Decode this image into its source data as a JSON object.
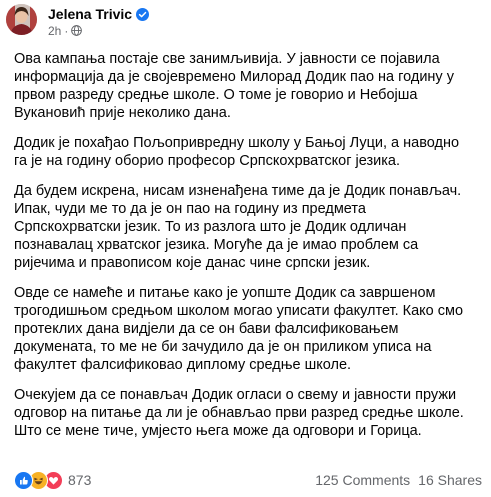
{
  "post": {
    "author_name": "Jelena Trivic",
    "time": "2h",
    "paragraphs": [
      {
        "lines": [
          "Ова кампања постаје све занимљивија. У јавности се појавила",
          "информација да је својевремено Милорад Додик пао на годину у",
          "првом разреду средње школе. О томе је говорио и Небојша",
          "Вукановић прије неколико дана."
        ]
      },
      {
        "lines": [
          "Додик је похађао Пољопривредну школу у Бањој Луци, а наводно",
          "га је на годину оборио професор Српскохрватског језика."
        ]
      },
      {
        "lines": [
          "Да будем искрена, нисам изненађена тиме да је Додик понављач.",
          "Ипак, чуди ме то да је он пао на годину из предмета",
          "Српскохрватски језик. То из разлога што је Додик одличан",
          "познавалац хрватског језика. Могуће да је имао проблем са",
          "ријечима и правописом које данас чине српски језик."
        ]
      },
      {
        "lines": [
          "Овде се намеће и питање како је уопште Додик са завршеном",
          "трогодишњом средњом школом могао уписати факултет. Како смо",
          "протеклих дана видјели да се он бави фалсификовањем",
          "докумената, то ме не би зачудило да је он приликом уписа на",
          "факултет фалсификовао диплому средње школе."
        ]
      },
      {
        "lines": [
          "Очекујем да се понављач Додик огласи о свему и јавности пружи",
          "одговор на питање да ли је обнављао први разред средње школе.",
          "Што се мене тиче, умјесто њега може да одговори и Горица."
        ]
      }
    ]
  },
  "footer": {
    "reaction_count": "873",
    "comments": "125 Comments",
    "shares": "16 Shares"
  },
  "icons": {
    "verified": "verified-badge-icon",
    "audience": "globe-icon",
    "reactions": [
      "like-icon",
      "haha-icon",
      "love-icon"
    ]
  },
  "colors": {
    "facebook_blue": "#1877f2",
    "love_red": "#f33e58",
    "haha_yellow": "#f7b125",
    "secondary_text": "#65676b"
  }
}
